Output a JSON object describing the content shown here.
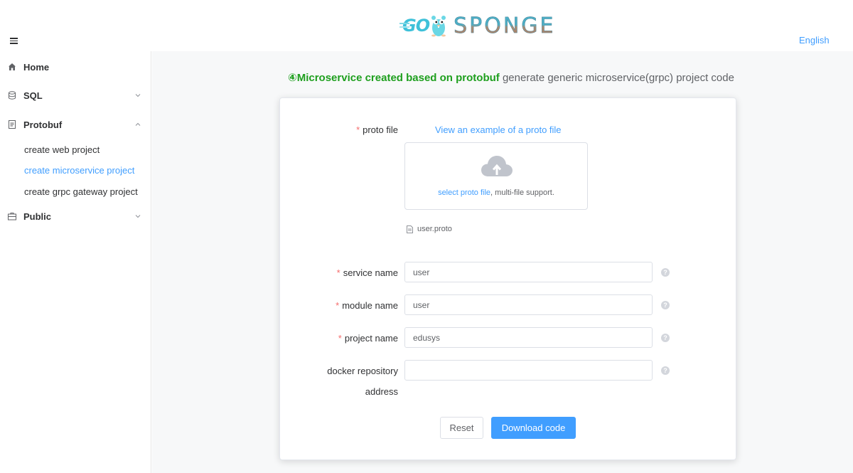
{
  "header": {
    "logo_go": "GO",
    "logo_sponge": "SPONGE",
    "language": "English"
  },
  "sidebar": {
    "items": [
      {
        "label": "Home",
        "icon": "home-icon"
      },
      {
        "label": "SQL",
        "icon": "database-icon",
        "expanded": false
      },
      {
        "label": "Protobuf",
        "icon": "document-icon",
        "expanded": true
      },
      {
        "label": "Public",
        "icon": "briefcase-icon",
        "expanded": false
      }
    ],
    "protobuf_sub": [
      {
        "label": "create web project",
        "active": false
      },
      {
        "label": "create microservice project",
        "active": true
      },
      {
        "label": "create grpc gateway project",
        "active": false
      }
    ]
  },
  "page": {
    "title_highlight": "④Microservice created based on protobuf",
    "title_desc": " generate generic microservice(grpc) project code"
  },
  "form": {
    "proto_file_label": "proto file",
    "example_link": "View an example of a proto file",
    "upload_link": "select proto file",
    "upload_hint": ", multi-file support.",
    "uploaded_file": "user.proto",
    "service_name_label": "service name",
    "service_name_value": "user",
    "module_name_label": "module name",
    "module_name_value": "user",
    "project_name_label": "project name",
    "project_name_value": "edusys",
    "docker_label_1": "docker repository",
    "docker_label_2": "address",
    "docker_value": "",
    "help_symbol": "?",
    "reset_label": "Reset",
    "download_label": "Download code"
  },
  "colors": {
    "accent": "#409eff",
    "title_green": "#1e9f1e",
    "required": "#f56c6c"
  }
}
